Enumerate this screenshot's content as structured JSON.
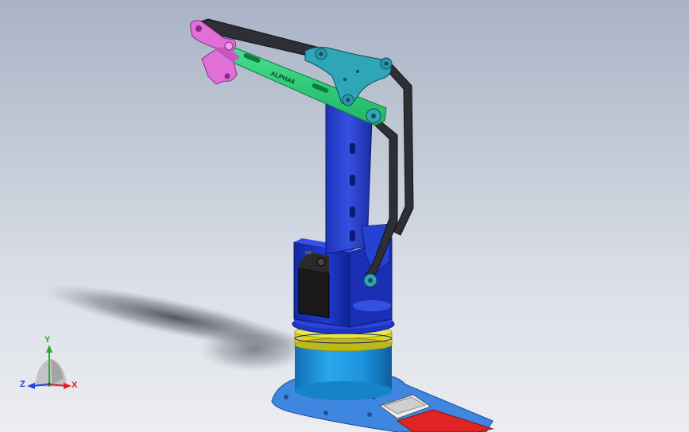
{
  "model": {
    "arm_text": "ALPHA6"
  },
  "triad": {
    "x_label": "X",
    "y_label": "Y",
    "z_label": "Z",
    "x_color": "#e02020",
    "y_color": "#20b020",
    "z_color": "#2040e0"
  },
  "colors": {
    "background_top": "#a9b3c6",
    "background_bottom": "#ecedf1",
    "base_plate": "#3f86e0",
    "cylinder": "#1fa2e6",
    "bearing_ring": "#d9d622",
    "servo_housing": "#1633c4",
    "column": "#2a3fd1",
    "upper_arm": "#2bd47a",
    "tri_link": "#2fa6b8",
    "gripper": "#e070d8",
    "linkage_bar": "#2e2e36",
    "servo_body": "#1a1a1a",
    "battery_red": "#e02424"
  }
}
